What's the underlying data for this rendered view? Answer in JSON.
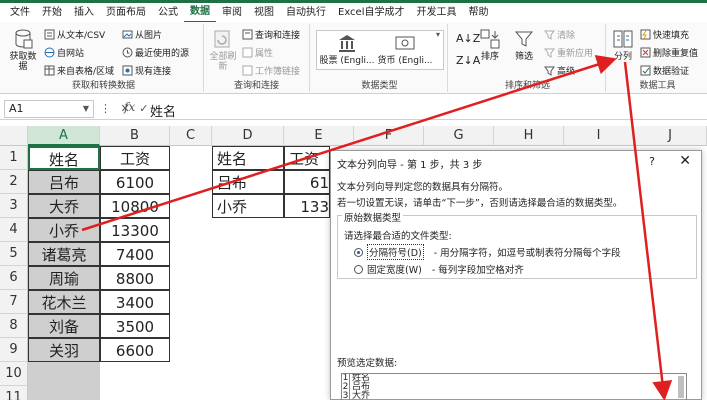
{
  "ribbon_tabs": [
    "文件",
    "开始",
    "插入",
    "页面布局",
    "公式",
    "数据",
    "审阅",
    "视图",
    "自动执行",
    "Excel自学成才",
    "开发工具",
    "帮助"
  ],
  "active_tab": "数据",
  "groups": {
    "get": {
      "label": "获取和转换数据",
      "big_button": "获取数据",
      "items": [
        "从文本/CSV",
        "自网站",
        "来自表格/区域",
        "从图片",
        "最近使用的源",
        "现有连接"
      ]
    },
    "query": {
      "label": "查询和连接",
      "big_button": "全部刷新",
      "items": [
        "查询和连接",
        "属性",
        "工作簿链接"
      ]
    },
    "types": {
      "label": "数据类型",
      "items": [
        "股票 (Engli...",
        "货币 (Engli..."
      ]
    },
    "sort": {
      "label": "排序和筛选",
      "items": [
        "排序",
        "筛选",
        "清除",
        "重新应用",
        "高级"
      ]
    },
    "tools": {
      "label": "数据工具",
      "big_button": "分列",
      "items": [
        "快速填充",
        "删除重复值",
        "数据验证"
      ]
    }
  },
  "formula_bar": {
    "name_box": "A1",
    "fx": "fx",
    "content": "姓名"
  },
  "columns": [
    "A",
    "B",
    "C",
    "D",
    "E",
    "F",
    "G",
    "H",
    "I",
    "J"
  ],
  "rows": [
    "1",
    "2",
    "3",
    "4",
    "5",
    "6",
    "7",
    "8",
    "9",
    "10",
    "11"
  ],
  "sheet_ab": [
    [
      "姓名",
      "工资"
    ],
    [
      "吕布",
      "6100"
    ],
    [
      "大乔",
      "10800"
    ],
    [
      "小乔",
      "13300"
    ],
    [
      "诸葛亮",
      "7400"
    ],
    [
      "周瑜",
      "8800"
    ],
    [
      "花木兰",
      "3400"
    ],
    [
      "刘备",
      "3500"
    ],
    [
      "关羽",
      "6600"
    ]
  ],
  "sheet_de": [
    [
      "姓名",
      "工资"
    ],
    [
      "吕布",
      "61"
    ],
    [
      "小乔",
      "133"
    ]
  ],
  "dialog": {
    "title": "文本分列向导 - 第 1 步，共 3 步",
    "help": "?",
    "close": "✕",
    "line1": "文本分列向导判定您的数据具有分隔符。",
    "line2": "若一切设置无误，请单击“下一步”，否则请选择最合适的数据类型。",
    "box_title": "原始数据类型",
    "prompt": "请选择最合适的文件类型:",
    "option1": "分隔符号(D)",
    "option1_desc": "- 用分隔字符，如逗号或制表符分隔每个字段",
    "option2": "固定宽度(W)",
    "option2_desc": "- 每列字段加空格对齐",
    "preview_label": "预览选定数据:",
    "preview_rows": [
      {
        "n": "1",
        "text": "姓名"
      },
      {
        "n": "2",
        "text": "吕布"
      },
      {
        "n": "3",
        "text": "大乔"
      }
    ]
  },
  "annotation_color": "#e02020"
}
